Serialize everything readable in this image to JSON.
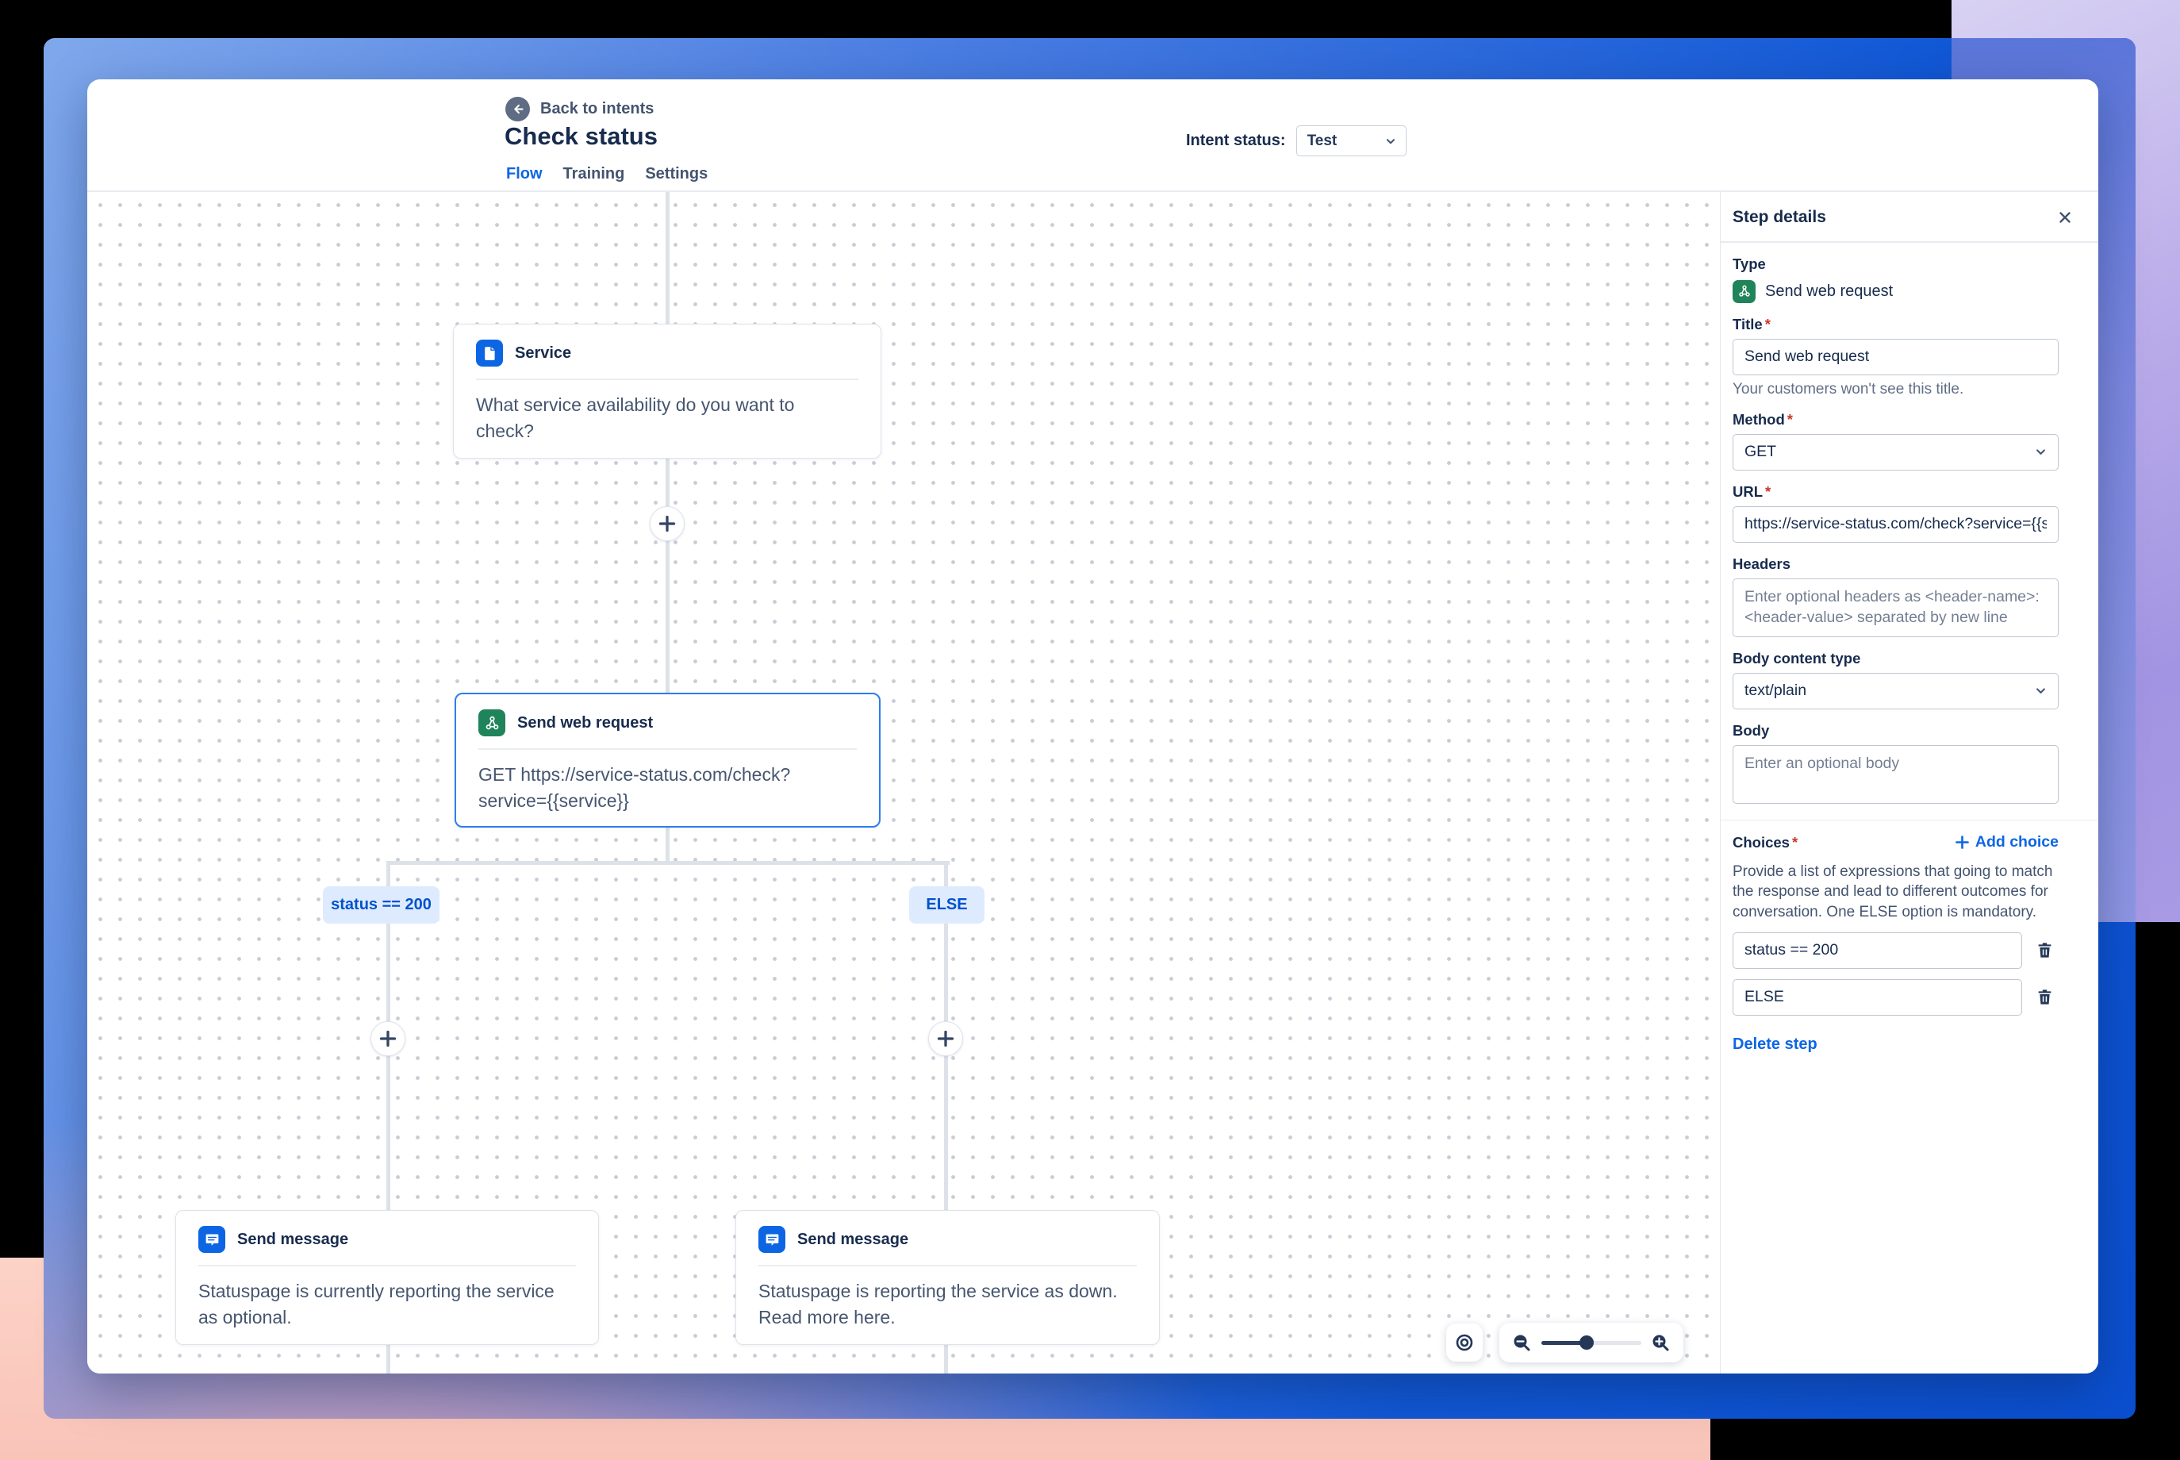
{
  "window": {
    "back_label": "Back to intents",
    "title": "Check status",
    "tabs": [
      {
        "label": "Flow",
        "active": true
      },
      {
        "label": "Training",
        "active": false
      },
      {
        "label": "Settings",
        "active": false
      }
    ],
    "intent_status": {
      "label": "Intent status:",
      "value": "Test"
    }
  },
  "canvas": {
    "nodes": [
      {
        "type": "service",
        "icon": "document-icon",
        "title": "Service",
        "body": "What service availability do you want to check?",
        "selected": false
      },
      {
        "type": "send-web-request",
        "icon": "web-request-icon",
        "title": "Send web request",
        "body": "GET https://service-status.com/check?service={{service}}",
        "selected": true
      },
      {
        "type": "send-message",
        "icon": "message-icon",
        "title": "Send message",
        "body": "Statuspage is currently reporting the service as optional.",
        "selected": false
      },
      {
        "type": "send-message",
        "icon": "message-icon",
        "title": "Send message",
        "body": "Statuspage is reporting the service as down. Read more here.",
        "selected": false
      }
    ],
    "branch_labels": [
      "status == 200",
      "ELSE"
    ]
  },
  "zoom_controls": {
    "slider_value_pct": 45
  },
  "panel": {
    "title": "Step details",
    "required_mark": "*",
    "type": {
      "label": "Type",
      "value": "Send web request"
    },
    "title_field": {
      "label": "Title",
      "value": "Send web request",
      "helper": "Your customers won't see this title."
    },
    "method_field": {
      "label": "Method",
      "value": "GET"
    },
    "url_field": {
      "label": "URL",
      "value": "https://service-status.com/check?service={{service}}"
    },
    "headers_field": {
      "label": "Headers",
      "placeholder": "Enter optional headers as <header-name>: <header-value> separated by new line"
    },
    "body_content_type_field": {
      "label": "Body content type",
      "value": "text/plain"
    },
    "body_field": {
      "label": "Body",
      "placeholder": "Enter an optional body"
    },
    "choices": {
      "label": "Choices",
      "add_label": "Add choice",
      "description": "Provide a list of expressions that going to match the response and lead to different outcomes for conversation. One ELSE option is mandatory.",
      "items": [
        "status == 200",
        "ELSE"
      ]
    },
    "delete_label": "Delete step"
  },
  "colors": {
    "accent_blue": "#0C66E4",
    "node_green": "#1F845A",
    "chip_bg": "#DEEBFF",
    "chip_text": "#0052CC",
    "selected_border": "#2E7DF0",
    "text_primary": "#172B4D",
    "text_secondary": "#44546F",
    "text_muted": "#626F86",
    "frame_black": "#000000",
    "frame_peach": "#FBC9BC",
    "frame_purple": "#A99BE3",
    "frame_blue": "#1158D6"
  }
}
